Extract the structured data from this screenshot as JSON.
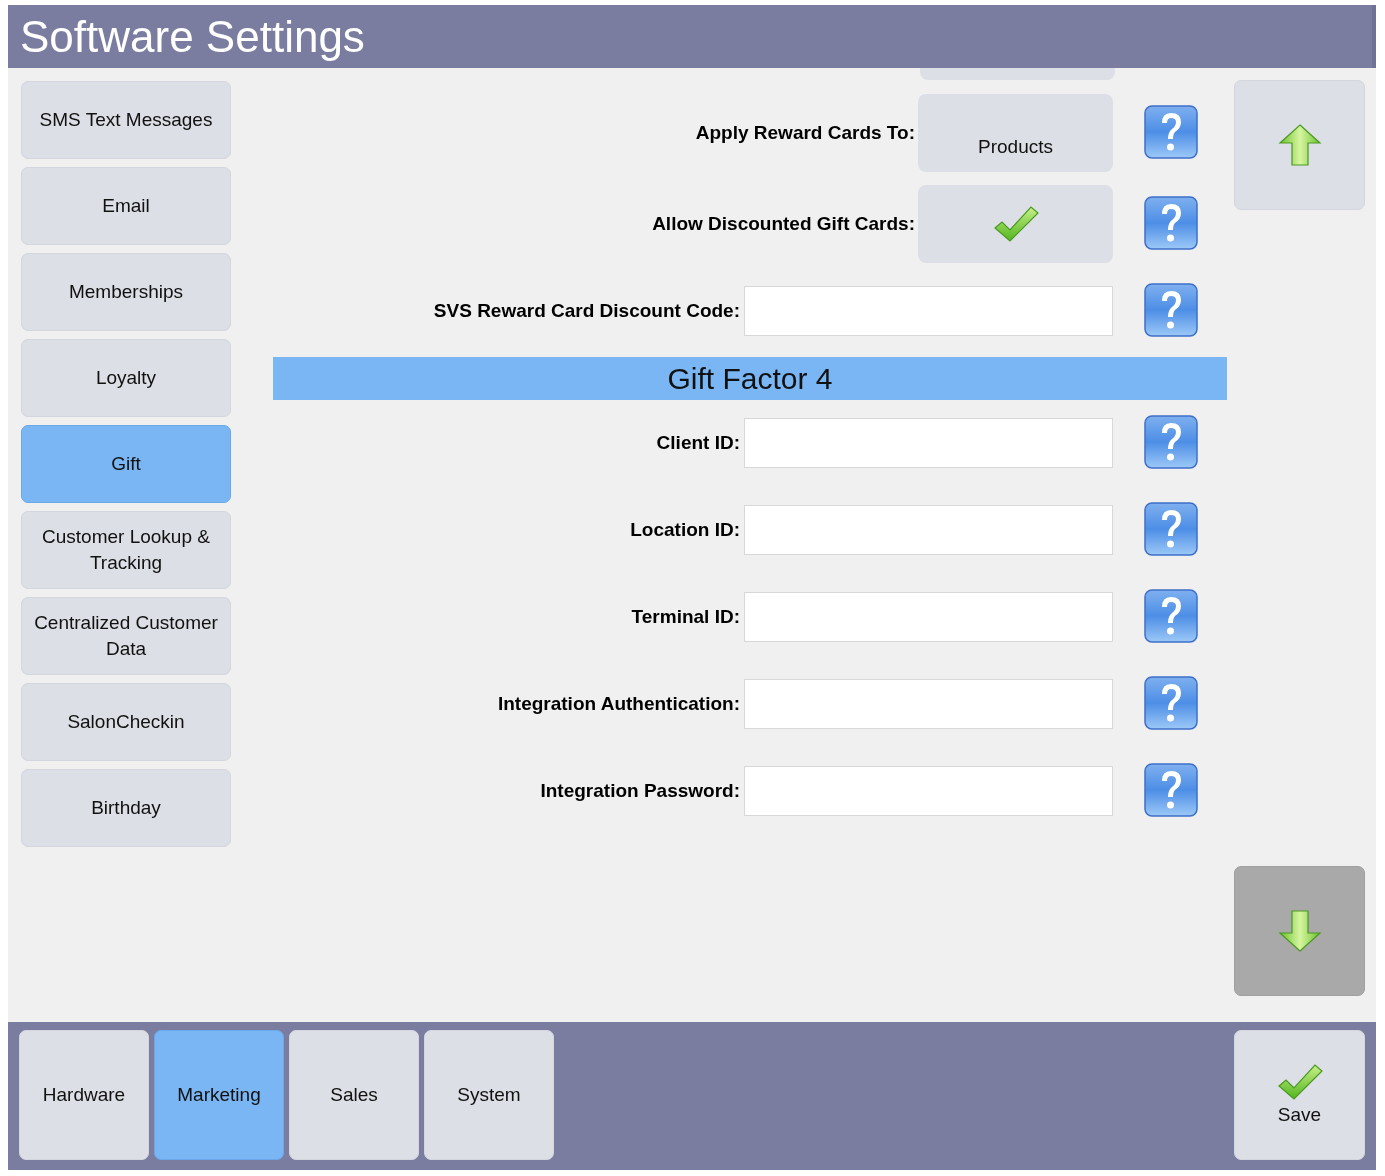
{
  "window": {
    "title": "Software Settings"
  },
  "sidebar": {
    "items": [
      {
        "label": "SMS Text Messages",
        "selected": false
      },
      {
        "label": "Email",
        "selected": false
      },
      {
        "label": "Memberships",
        "selected": false
      },
      {
        "label": "Loyalty",
        "selected": false
      },
      {
        "label": "Gift",
        "selected": true
      },
      {
        "label": "Customer Lookup & Tracking",
        "selected": false
      },
      {
        "label": "Centralized Customer Data",
        "selected": false
      },
      {
        "label": "SalonCheckin",
        "selected": false
      },
      {
        "label": "Birthday",
        "selected": false
      }
    ]
  },
  "settings": [
    {
      "kind": "choice",
      "label": "Apply Reward Cards To:",
      "value": "Products"
    },
    {
      "kind": "toggle",
      "label": "Allow Discounted Gift Cards:",
      "checked": true
    },
    {
      "kind": "text",
      "label": "SVS Reward Card Discount Code:"
    },
    {
      "kind": "section",
      "title": "Gift Factor 4"
    },
    {
      "kind": "text",
      "label": "Client ID:"
    },
    {
      "kind": "text",
      "label": "Location ID:"
    },
    {
      "kind": "text",
      "label": "Terminal ID:"
    },
    {
      "kind": "text",
      "label": "Integration Authentication:"
    },
    {
      "kind": "text",
      "label": "Integration Password:"
    }
  ],
  "scroll_buttons": [
    {
      "kind": "up",
      "pressed": false
    },
    {
      "kind": "down",
      "pressed": true
    }
  ],
  "tabs": [
    {
      "label": "Hardware",
      "selected": false
    },
    {
      "label": "Marketing",
      "selected": true
    },
    {
      "label": "Sales",
      "selected": false
    },
    {
      "label": "System",
      "selected": false
    }
  ],
  "save_button": {
    "label": "Save"
  }
}
